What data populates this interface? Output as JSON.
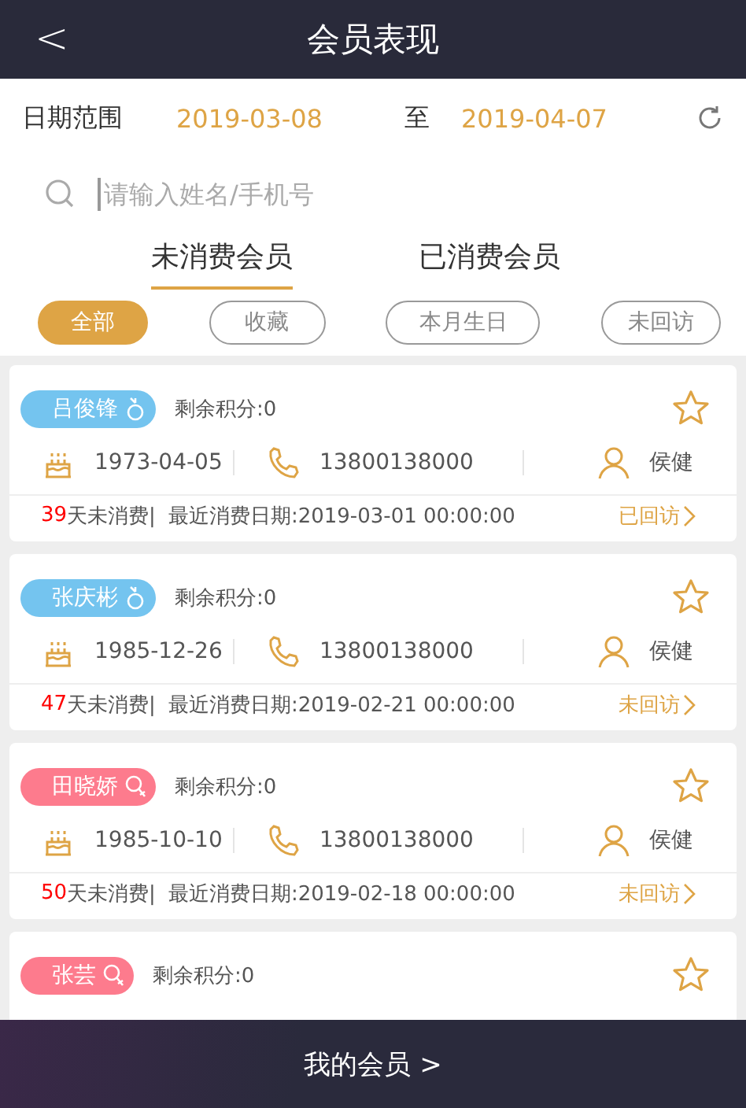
{
  "header": {
    "back": "<",
    "title": "会员表现"
  },
  "date_range": {
    "label": "日期范围",
    "start": "2019-03-08",
    "separator": "至",
    "end": "2019-04-07"
  },
  "search": {
    "placeholder": "请输入姓名/手机号"
  },
  "tabs": [
    {
      "label": "未消费会员",
      "selected": true
    },
    {
      "label": "已消费会员",
      "selected": false
    }
  ],
  "filters": [
    {
      "label": "全部",
      "selected": true
    },
    {
      "label": "收藏",
      "selected": false
    },
    {
      "label": "本月生日",
      "selected": false
    },
    {
      "label": "未回访",
      "selected": false
    }
  ],
  "members": [
    {
      "name": "吕俊锋",
      "kind": "male",
      "points": "剩余积分:0",
      "favorite": false,
      "birthday": "1973-04-05",
      "phone": "13800138000",
      "staff": "侯健",
      "days": "39",
      "days_label": "天未消费|",
      "last_date": "最近消费日期:2019-03-01 00:00:00",
      "visit": "已回访"
    },
    {
      "name": "张庆彬",
      "kind": "male",
      "points": "剩余积分:0",
      "favorite": false,
      "birthday": "1985-12-26",
      "phone": "13800138000",
      "staff": "侯健",
      "days": "47",
      "days_label": "天未消费|",
      "last_date": "最近消费日期:2019-02-21 00:00:00",
      "visit": "未回访"
    },
    {
      "name": "田晓娇",
      "kind": "female",
      "points": "剩余积分:0",
      "favorite": false,
      "birthday": "1985-10-10",
      "phone": "13800138000",
      "staff": "侯健",
      "days": "50",
      "days_label": "天未消费|",
      "last_date": "最近消费日期:2019-02-18 00:00:00",
      "visit": "未回访"
    },
    {
      "name": "张芸",
      "kind": "female",
      "points": "剩余积分:0",
      "favorite": false
    }
  ],
  "bottom_button": "我的会员 >"
}
